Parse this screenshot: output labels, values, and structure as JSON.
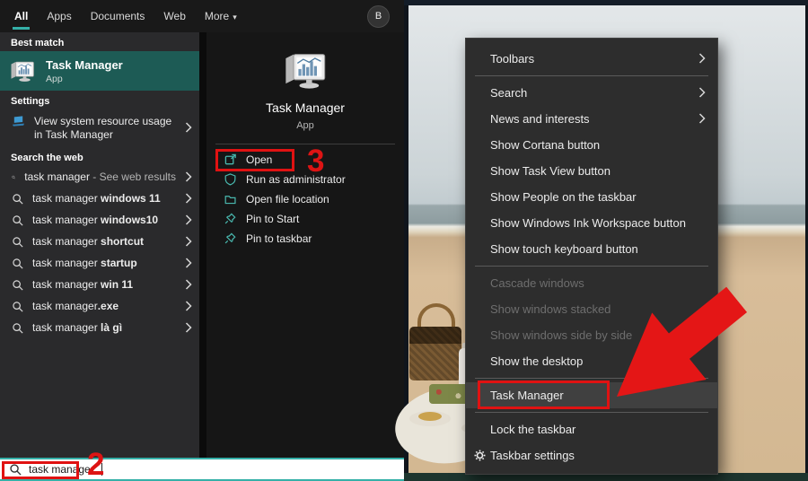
{
  "colors": {
    "accent_teal": "#35b0a8",
    "best_match_bg": "#1d5b55",
    "annotation_red": "#e01212",
    "menu_bg": "#2d2d2d",
    "action_icon_teal": "#49b8ae"
  },
  "icons": {
    "more_caret": "▾"
  },
  "search_window": {
    "tabs": [
      {
        "label": "All"
      },
      {
        "label": "Apps"
      },
      {
        "label": "Documents"
      },
      {
        "label": "Web"
      },
      {
        "label": "More"
      }
    ],
    "avatar_initial": "B",
    "best_match_header": "Best match",
    "best_match": {
      "title": "Task Manager",
      "subtitle": "App"
    },
    "settings_header": "Settings",
    "settings_item": {
      "label": "View system resource usage in Task Manager"
    },
    "web_header": "Search the web",
    "web_result": {
      "query": "task manager",
      "hint": " - See web results"
    },
    "suggestions": [
      {
        "prefix": "task manager",
        "bold": " windows 11"
      },
      {
        "prefix": "task manager",
        "bold": " windows10"
      },
      {
        "prefix": "task manager",
        "bold": " shortcut"
      },
      {
        "prefix": "task manager",
        "bold": " startup"
      },
      {
        "prefix": "task manager",
        "bold": " win 11"
      },
      {
        "prefix": "task manager",
        "bold": ".exe"
      },
      {
        "prefix": "task manager",
        "bold": " là gì"
      }
    ],
    "detail": {
      "title": "Task Manager",
      "subtitle": "App",
      "actions": [
        {
          "label": "Open"
        },
        {
          "label": "Run as administrator"
        },
        {
          "label": "Open file location"
        },
        {
          "label": "Pin to Start"
        },
        {
          "label": "Pin to taskbar"
        }
      ]
    },
    "search_box": {
      "value": "task manager"
    }
  },
  "context_menu": {
    "items": [
      {
        "label": "Toolbars"
      },
      {
        "label": "Search"
      },
      {
        "label": "News and interests"
      },
      {
        "label": "Show Cortana button"
      },
      {
        "label": "Show Task View button"
      },
      {
        "label": "Show People on the taskbar"
      },
      {
        "label": "Show Windows Ink Workspace button"
      },
      {
        "label": "Show touch keyboard button"
      },
      {
        "label": "Cascade windows"
      },
      {
        "label": "Show windows stacked"
      },
      {
        "label": "Show windows side by side"
      },
      {
        "label": "Show the desktop"
      },
      {
        "label": "Task Manager"
      },
      {
        "label": "Lock the taskbar"
      },
      {
        "label": "Taskbar settings"
      }
    ]
  },
  "annotations": {
    "step_2": "2",
    "step_3": "3"
  }
}
